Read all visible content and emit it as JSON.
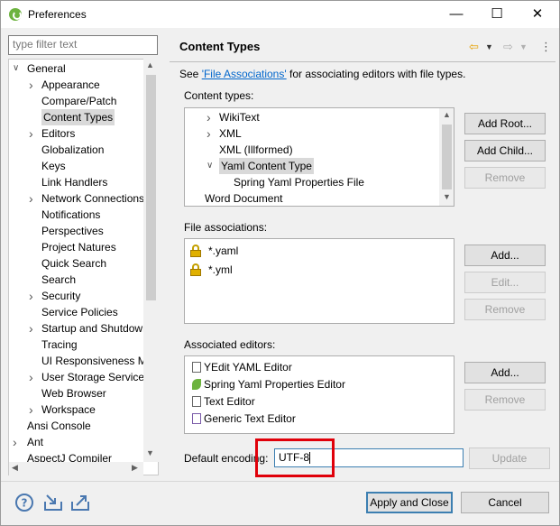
{
  "window": {
    "title": "Preferences"
  },
  "filter": {
    "placeholder": "type filter text"
  },
  "tree": [
    {
      "label": "General",
      "arrow": "down"
    },
    {
      "label": "Appearance",
      "arrow": "right"
    },
    {
      "label": "Compare/Patch",
      "arrow": ""
    },
    {
      "label": "Content Types",
      "arrow": "",
      "selected": true
    },
    {
      "label": "Editors",
      "arrow": "right"
    },
    {
      "label": "Globalization",
      "arrow": ""
    },
    {
      "label": "Keys",
      "arrow": ""
    },
    {
      "label": "Link Handlers",
      "arrow": ""
    },
    {
      "label": "Network Connections",
      "arrow": "right"
    },
    {
      "label": "Notifications",
      "arrow": ""
    },
    {
      "label": "Perspectives",
      "arrow": ""
    },
    {
      "label": "Project Natures",
      "arrow": ""
    },
    {
      "label": "Quick Search",
      "arrow": ""
    },
    {
      "label": "Search",
      "arrow": ""
    },
    {
      "label": "Security",
      "arrow": "right"
    },
    {
      "label": "Service Policies",
      "arrow": ""
    },
    {
      "label": "Startup and Shutdown",
      "arrow": "right"
    },
    {
      "label": "Tracing",
      "arrow": ""
    },
    {
      "label": "UI Responsiveness M",
      "arrow": ""
    },
    {
      "label": "User Storage Service",
      "arrow": "right"
    },
    {
      "label": "Web Browser",
      "arrow": ""
    },
    {
      "label": "Workspace",
      "arrow": "right"
    },
    {
      "label": "Ansi Console",
      "arrow": ""
    },
    {
      "label": "Ant",
      "arrow": "right"
    },
    {
      "label": "AspectJ Compiler",
      "arrow": ""
    }
  ],
  "page": {
    "title": "Content Types",
    "see_prefix": "See ",
    "see_link": "'File Associations'",
    "see_suffix": " for associating editors with file types.",
    "content_types_label": "Content types:",
    "file_assoc_label": "File associations:",
    "assoc_editors_label": "Associated editors:",
    "encoding_label": "Default encoding:",
    "encoding_value": "UTF-8"
  },
  "content_types": [
    {
      "label": "WikiText",
      "arrow": "right"
    },
    {
      "label": "XML",
      "arrow": "right"
    },
    {
      "label": "XML (Illformed)",
      "arrow": ""
    },
    {
      "label": "Yaml Content Type",
      "arrow": "down",
      "selected": true
    },
    {
      "label": "Spring Yaml Properties File",
      "arrow": ""
    },
    {
      "label": "Word Document",
      "arrow": ""
    }
  ],
  "file_associations": [
    "*.yaml",
    "*.yml"
  ],
  "editors": [
    "YEdit YAML Editor",
    "Spring Yaml Properties Editor",
    "Text Editor",
    "Generic Text Editor"
  ],
  "buttons": {
    "add_root": "Add Root...",
    "add_child": "Add Child...",
    "remove": "Remove",
    "add": "Add...",
    "edit": "Edit...",
    "update": "Update",
    "apply_close": "Apply and Close",
    "cancel": "Cancel"
  },
  "window_buttons": {
    "minimize": "—",
    "maximize": "☐",
    "close": "✕"
  },
  "colors": {
    "accent": "#0066cc",
    "highlight": "#e0000a",
    "selection": "#d9d9d9"
  }
}
